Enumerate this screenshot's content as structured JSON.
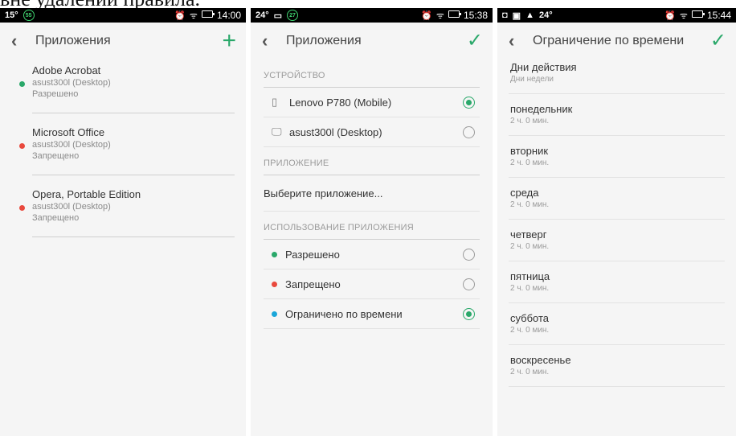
{
  "cutoff_caption": "вне удалении правила.",
  "panel1": {
    "status": {
      "temp": "15°",
      "badge": "55",
      "time": "14:00",
      "battery": "55"
    },
    "title": "Приложения",
    "apps": [
      {
        "name": "Adobe Acrobat",
        "device": "asust300l (Desktop)",
        "status": "Разрешено",
        "color": "#2aa86a"
      },
      {
        "name": "Microsoft Office",
        "device": "asust300l (Desktop)",
        "status": "Запрещено",
        "color": "#e9493d"
      },
      {
        "name": "Opera, Portable Edition",
        "device": "asust300l (Desktop)",
        "status": "Запрещено",
        "color": "#e9493d"
      }
    ]
  },
  "panel2": {
    "status": {
      "temp": "24°",
      "badge": "27",
      "time": "15:38"
    },
    "title": "Приложения",
    "device_header": "УСТРОЙСТВО",
    "devices": [
      {
        "label": "Lenovo P780 (Mobile)",
        "selected": true
      },
      {
        "label": "asust300l (Desktop)",
        "selected": false
      }
    ],
    "app_header": "ПРИЛОЖЕНИЕ",
    "choose_app": "Выберите приложение...",
    "usage_header": "ИСПОЛЬЗОВАНИЕ ПРИЛОЖЕНИЯ",
    "usage": [
      {
        "label": "Разрешено",
        "color": "#2aa86a",
        "selected": false
      },
      {
        "label": "Запрещено",
        "color": "#e9493d",
        "selected": false
      },
      {
        "label": "Ограничено по времени",
        "color": "#1aa6d9",
        "selected": true
      }
    ]
  },
  "panel3": {
    "status": {
      "temp": "24°",
      "time": "15:44"
    },
    "title": "Ограничение по времени",
    "days_header": "Дни действия",
    "days_sub": "Дни недели",
    "days": [
      {
        "name": "понедельник",
        "value": "2 ч. 0 мин."
      },
      {
        "name": "вторник",
        "value": "2 ч. 0 мин."
      },
      {
        "name": "среда",
        "value": "2 ч. 0 мин."
      },
      {
        "name": "четверг",
        "value": "2 ч. 0 мин."
      },
      {
        "name": "пятница",
        "value": "2 ч. 0 мин."
      },
      {
        "name": "суббота",
        "value": "2 ч. 0 мин."
      },
      {
        "name": "воскресенье",
        "value": "2 ч. 0 мин."
      }
    ]
  }
}
